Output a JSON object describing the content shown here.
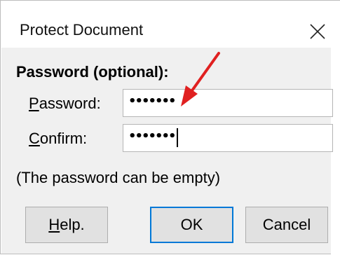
{
  "dialog": {
    "title": "Protect Document",
    "heading": "Password (optional):",
    "note": "(The password can be empty)"
  },
  "fields": {
    "password": {
      "label_mnemonic": "P",
      "label_rest": "assword:",
      "masked_value": "•••••••"
    },
    "confirm": {
      "label_mnemonic": "C",
      "label_rest": "onfirm:",
      "masked_value": "•••••••"
    }
  },
  "buttons": {
    "help": {
      "mnemonic": "H",
      "rest": "elp."
    },
    "ok": {
      "label": "OK"
    },
    "cancel": {
      "label": "Cancel"
    }
  },
  "icons": {
    "close": "close-icon",
    "annotation": "red-arrow-annotation"
  },
  "colors": {
    "annotation": "#e02020",
    "default_button_border": "#0078d7",
    "dialog_background": "#f0f0f0"
  }
}
